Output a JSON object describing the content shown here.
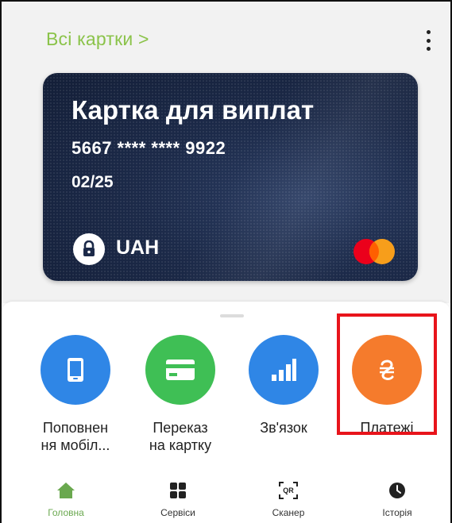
{
  "header": {
    "all_cards_link": "Всі картки >"
  },
  "card": {
    "title": "Картка для виплат",
    "number": "5667 **** **** 9922",
    "expiry": "02/25",
    "currency": "UAH",
    "brand_icon": "mastercard-logo"
  },
  "actions": [
    {
      "label_line1": "Поповнен",
      "label_line2": "ня мобіл...",
      "icon": "mobile-phone-icon",
      "color": "#2f86e6"
    },
    {
      "label_line1": "Переказ",
      "label_line2": "на картку",
      "icon": "credit-card-icon",
      "color": "#3fbf55"
    },
    {
      "label_line1": "Зв'язок",
      "label_line2": "",
      "icon": "signal-bars-icon",
      "color": "#2f86e6"
    },
    {
      "label_line1": "Платежі",
      "label_line2": "",
      "icon": "hryvnia-icon",
      "color": "#f57b2c"
    }
  ],
  "bottom_nav": [
    {
      "label": "Головна",
      "icon": "home-icon",
      "active": true
    },
    {
      "label": "Сервіси",
      "icon": "grid-icon",
      "active": false
    },
    {
      "label": "Сканер",
      "icon": "qr-scanner-icon",
      "active": false
    },
    {
      "label": "Історія",
      "icon": "clock-icon",
      "active": false
    }
  ],
  "colors": {
    "accent_green": "#8bc34a",
    "highlight_red": "#e8141b",
    "card_navy": "#1c2a49"
  }
}
